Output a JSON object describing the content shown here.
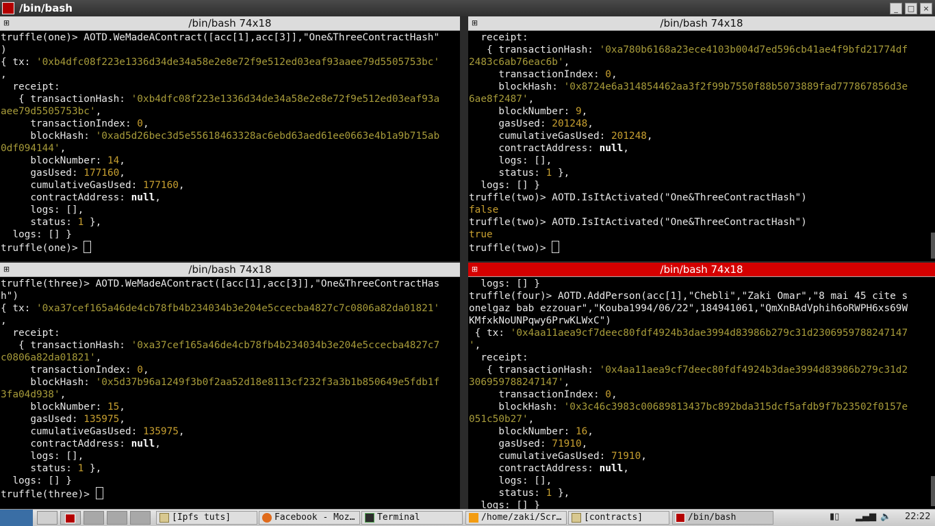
{
  "window": {
    "title": "/bin/bash"
  },
  "colors": {
    "active_header": "#d40000",
    "string": "#a89c3a",
    "number": "#c8a030"
  },
  "panes": {
    "tl": {
      "header": "/bin/bash 74x18"
    },
    "tr": {
      "header": "/bin/bash 74x18"
    },
    "bl": {
      "header": "/bin/bash 74x18"
    },
    "br": {
      "header": "/bin/bash 74x18"
    }
  },
  "terminal": {
    "tl": [
      [
        [
          "p",
          "truffle(one)> AOTD.WeMadeAContract([acc[1],acc[3]],\"One&ThreeContractHash\""
        ]
      ],
      [
        [
          "p",
          ")"
        ]
      ],
      [
        [
          "p",
          "{ tx: "
        ],
        [
          "s",
          "'0xb4dfc08f223e1336d34de34a58e2e8e72f9e512ed03eaf93aaee79d5505753bc'"
        ]
      ],
      [
        [
          "p",
          ","
        ]
      ],
      [
        [
          "p",
          "  receipt:"
        ]
      ],
      [
        [
          "p",
          "   { transactionHash: "
        ],
        [
          "s",
          "'0xb4dfc08f223e1336d34de34a58e2e8e72f9e512ed03eaf93a"
        ]
      ],
      [
        [
          "s",
          "aee79d5505753bc'"
        ],
        [
          "p",
          ","
        ]
      ],
      [
        [
          "p",
          "     transactionIndex: "
        ],
        [
          "n",
          "0"
        ],
        [
          "p",
          ","
        ]
      ],
      [
        [
          "p",
          "     blockHash: "
        ],
        [
          "s",
          "'0xad5d26bec3d5e55618463328ac6ebd63aed61ee0663e4b1a9b715ab"
        ]
      ],
      [
        [
          "s",
          "0df094144'"
        ],
        [
          "p",
          ","
        ]
      ],
      [
        [
          "p",
          "     blockNumber: "
        ],
        [
          "n",
          "14"
        ],
        [
          "p",
          ","
        ]
      ],
      [
        [
          "p",
          "     gasUsed: "
        ],
        [
          "n",
          "177160"
        ],
        [
          "p",
          ","
        ]
      ],
      [
        [
          "p",
          "     cumulativeGasUsed: "
        ],
        [
          "n",
          "177160"
        ],
        [
          "p",
          ","
        ]
      ],
      [
        [
          "p",
          "     contractAddress: "
        ],
        [
          "k",
          "null"
        ],
        [
          "p",
          ","
        ]
      ],
      [
        [
          "p",
          "     logs: [],"
        ]
      ],
      [
        [
          "p",
          "     status: "
        ],
        [
          "n",
          "1"
        ],
        [
          "p",
          " },"
        ]
      ],
      [
        [
          "p",
          "  logs: [] }"
        ]
      ],
      [
        [
          "p",
          "truffle(one)> "
        ],
        [
          "c",
          ""
        ]
      ]
    ],
    "tr": [
      [
        [
          "p",
          "  receipt:"
        ]
      ],
      [
        [
          "p",
          "   { transactionHash: "
        ],
        [
          "s",
          "'0xa780b6168a23ece4103b004d7ed596cb41ae4f9bfd21774df"
        ]
      ],
      [
        [
          "s",
          "2483c6ab76eac6b'"
        ],
        [
          "p",
          ","
        ]
      ],
      [
        [
          "p",
          "     transactionIndex: "
        ],
        [
          "n",
          "0"
        ],
        [
          "p",
          ","
        ]
      ],
      [
        [
          "p",
          "     blockHash: "
        ],
        [
          "s",
          "'0x8724e6a314854462aa3f2f99b7550f88b5073889fad777867856d3e"
        ]
      ],
      [
        [
          "s",
          "6ae8f2487'"
        ],
        [
          "p",
          ","
        ]
      ],
      [
        [
          "p",
          "     blockNumber: "
        ],
        [
          "n",
          "9"
        ],
        [
          "p",
          ","
        ]
      ],
      [
        [
          "p",
          "     gasUsed: "
        ],
        [
          "n",
          "201248"
        ],
        [
          "p",
          ","
        ]
      ],
      [
        [
          "p",
          "     cumulativeGasUsed: "
        ],
        [
          "n",
          "201248"
        ],
        [
          "p",
          ","
        ]
      ],
      [
        [
          "p",
          "     contractAddress: "
        ],
        [
          "k",
          "null"
        ],
        [
          "p",
          ","
        ]
      ],
      [
        [
          "p",
          "     logs: [],"
        ]
      ],
      [
        [
          "p",
          "     status: "
        ],
        [
          "n",
          "1"
        ],
        [
          "p",
          " },"
        ]
      ],
      [
        [
          "p",
          "  logs: [] }"
        ]
      ],
      [
        [
          "p",
          "truffle(two)> AOTD.IsItActivated(\"One&ThreeContractHash\")"
        ]
      ],
      [
        [
          "f",
          "false"
        ]
      ],
      [
        [
          "p",
          "truffle(two)> AOTD.IsItActivated(\"One&ThreeContractHash\")"
        ]
      ],
      [
        [
          "f",
          "true"
        ]
      ],
      [
        [
          "p",
          "truffle(two)> "
        ],
        [
          "c",
          ""
        ]
      ]
    ],
    "bl": [
      [
        [
          "p",
          "truffle(three)> AOTD.WeMadeAContract([acc[1],acc[3]],\"One&ThreeContractHas"
        ]
      ],
      [
        [
          "p",
          "h\")"
        ]
      ],
      [
        [
          "p",
          "{ tx: "
        ],
        [
          "s",
          "'0xa37cef165a46de4cb78fb4b234034b3e204e5ccecba4827c7c0806a82da01821'"
        ]
      ],
      [
        [
          "p",
          ","
        ]
      ],
      [
        [
          "p",
          "  receipt:"
        ]
      ],
      [
        [
          "p",
          "   { transactionHash: "
        ],
        [
          "s",
          "'0xa37cef165a46de4cb78fb4b234034b3e204e5ccecba4827c7"
        ]
      ],
      [
        [
          "s",
          "c0806a82da01821'"
        ],
        [
          "p",
          ","
        ]
      ],
      [
        [
          "p",
          "     transactionIndex: "
        ],
        [
          "n",
          "0"
        ],
        [
          "p",
          ","
        ]
      ],
      [
        [
          "p",
          "     blockHash: "
        ],
        [
          "s",
          "'0x5d37b96a1249f3b0f2aa52d18e8113cf232f3a3b1b850649e5fdb1f"
        ]
      ],
      [
        [
          "s",
          "3fa04d938'"
        ],
        [
          "p",
          ","
        ]
      ],
      [
        [
          "p",
          "     blockNumber: "
        ],
        [
          "n",
          "15"
        ],
        [
          "p",
          ","
        ]
      ],
      [
        [
          "p",
          "     gasUsed: "
        ],
        [
          "n",
          "135975"
        ],
        [
          "p",
          ","
        ]
      ],
      [
        [
          "p",
          "     cumulativeGasUsed: "
        ],
        [
          "n",
          "135975"
        ],
        [
          "p",
          ","
        ]
      ],
      [
        [
          "p",
          "     contractAddress: "
        ],
        [
          "k",
          "null"
        ],
        [
          "p",
          ","
        ]
      ],
      [
        [
          "p",
          "     logs: [],"
        ]
      ],
      [
        [
          "p",
          "     status: "
        ],
        [
          "n",
          "1"
        ],
        [
          "p",
          " },"
        ]
      ],
      [
        [
          "p",
          "  logs: [] }"
        ]
      ],
      [
        [
          "p",
          "truffle(three)> "
        ],
        [
          "c",
          ""
        ]
      ]
    ],
    "br": [
      [
        [
          "p",
          "  logs: [] }"
        ]
      ],
      [
        [
          "p",
          "truffle(four)> AOTD.AddPerson(acc[1],\"Chebli\",\"Zaki Omar\",\"8 mai 45 cite s"
        ]
      ],
      [
        [
          "p",
          "onelgaz bab ezzouar\",\"Kouba1994/06/22\",184941061,\"QmXnBAdVphih6oRWPH6xs69W"
        ]
      ],
      [
        [
          "p",
          "KMfxkNoUNPqwy6PrwKLWxC\")"
        ]
      ],
      [
        [
          "p",
          " { tx: "
        ],
        [
          "s",
          "'0x4aa11aea9cf7deec80fdf4924b3dae3994d83986b279c31d2306959788247147"
        ]
      ],
      [
        [
          "s",
          "'"
        ],
        [
          "p",
          ","
        ]
      ],
      [
        [
          "p",
          "  receipt:"
        ]
      ],
      [
        [
          "p",
          "   { transactionHash: "
        ],
        [
          "s",
          "'0x4aa11aea9cf7deec80fdf4924b3dae3994d83986b279c31d2"
        ]
      ],
      [
        [
          "s",
          "306959788247147'"
        ],
        [
          "p",
          ","
        ]
      ],
      [
        [
          "p",
          "     transactionIndex: "
        ],
        [
          "n",
          "0"
        ],
        [
          "p",
          ","
        ]
      ],
      [
        [
          "p",
          "     blockHash: "
        ],
        [
          "s",
          "'0x3c46c3983c00689813437bc892bda315dcf5afdb9f7b23502f0157e"
        ]
      ],
      [
        [
          "s",
          "051c50b27'"
        ],
        [
          "p",
          ","
        ]
      ],
      [
        [
          "p",
          "     blockNumber: "
        ],
        [
          "n",
          "16"
        ],
        [
          "p",
          ","
        ]
      ],
      [
        [
          "p",
          "     gasUsed: "
        ],
        [
          "n",
          "71910"
        ],
        [
          "p",
          ","
        ]
      ],
      [
        [
          "p",
          "     cumulativeGasUsed: "
        ],
        [
          "n",
          "71910"
        ],
        [
          "p",
          ","
        ]
      ],
      [
        [
          "p",
          "     contractAddress: "
        ],
        [
          "k",
          "null"
        ],
        [
          "p",
          ","
        ]
      ],
      [
        [
          "p",
          "     logs: [],"
        ]
      ],
      [
        [
          "p",
          "     status: "
        ],
        [
          "n",
          "1"
        ],
        [
          "p",
          " },"
        ]
      ],
      [
        [
          "p",
          "  logs: [] }"
        ]
      ]
    ]
  },
  "taskbar": {
    "items": [
      {
        "label": "[Ipfs tuts]",
        "icon": "folder-icon"
      },
      {
        "label": "Facebook - Moz…",
        "icon": "firefox-icon"
      },
      {
        "label": "Terminal",
        "icon": "terminal-icon"
      },
      {
        "label": "/home/zaki/Scr…",
        "icon": "sublime-icon"
      },
      {
        "label": "[contracts]",
        "icon": "folder-icon"
      },
      {
        "label": "/bin/bash",
        "icon": "terminator-icon"
      }
    ],
    "clock": "22:22"
  }
}
